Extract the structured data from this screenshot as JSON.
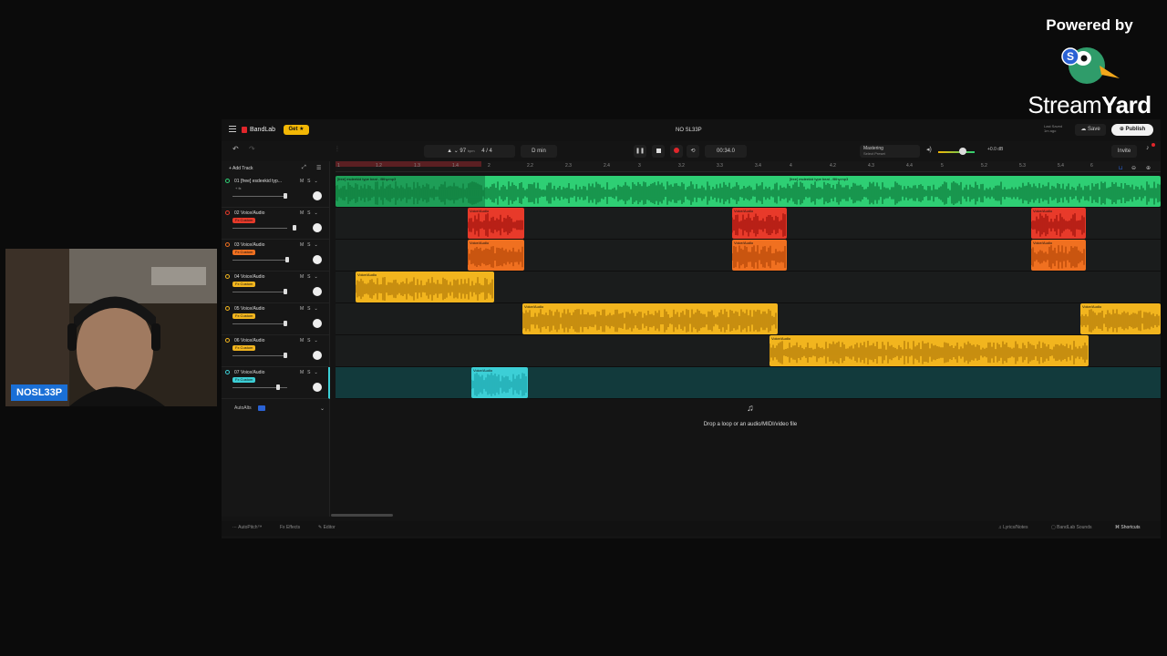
{
  "overlay": {
    "powered_by": "Powered by",
    "brand_name_light": "Stream",
    "brand_name_bold": "Yard",
    "brand_badge_letter": "S",
    "webcam_name": "NOSL33P"
  },
  "daw": {
    "app_name": "BandLab",
    "get_button": "Get",
    "project_title": "NO SL33P",
    "last_saved": "Last Saved",
    "last_saved_time": "1m ago",
    "save_label": "Save",
    "publish_label": "Publish",
    "invite_label": "Invite",
    "bpm": "97",
    "bpm_unit": "bpm",
    "time_signature": "4 / 4",
    "key": "D min",
    "time_display": "00:34.0",
    "mastering_label": "Mastering",
    "mastering_sub": "Select Preset",
    "db_value": "+0.0 dB",
    "add_track": "Add Track",
    "autoalts": "AutoAlts",
    "accent_color": "#f2b705",
    "record_color": "#e0262b"
  },
  "ruler": [
    "1",
    "1.2",
    "1.3",
    "1.4",
    "2",
    "2.2",
    "2.3",
    "2.4",
    "3",
    "3.2",
    "3.3",
    "3.4",
    "4",
    "4.2",
    "4.3",
    "4.4",
    "5",
    "5.2",
    "5.3",
    "5.4",
    "6"
  ],
  "tracks": [
    {
      "name": "01 [free] esdeekid typ...",
      "badge": "+ fx",
      "color": "#2ecf74"
    },
    {
      "name": "02 Voice/Audio",
      "badge": "Fx Custom",
      "color": "#e83a2a"
    },
    {
      "name": "03 Voice/Audio",
      "badge": "Fx Custom",
      "color": "#f07020"
    },
    {
      "name": "04 Voice/Audio",
      "badge": "Fx Custom",
      "color": "#f2b51e"
    },
    {
      "name": "05 Voice/Audio",
      "badge": "Fx Custom",
      "color": "#f2b51e"
    },
    {
      "name": "06 Voice/Audio",
      "badge": "Fx Custom",
      "color": "#f2b51e"
    },
    {
      "name": "07 Voice/Audio",
      "badge": "Fx Custom",
      "color": "#3ccfd6"
    }
  ],
  "clips": {
    "beat_label": "[free] esdeekid type beat - filthy.mp3",
    "voice_label": "Voice/Audio"
  },
  "drop_zone": {
    "icon": "music-note",
    "text": "Drop a loop or an audio/MIDI/video file"
  },
  "bottom": {
    "autopitch": "AutoPitch™",
    "effects": "Effects",
    "editor": "Editor",
    "lyrics": "Lyrics/Notes",
    "sounds": "BandLab Sounds",
    "shortcuts": "Shortcuts"
  }
}
